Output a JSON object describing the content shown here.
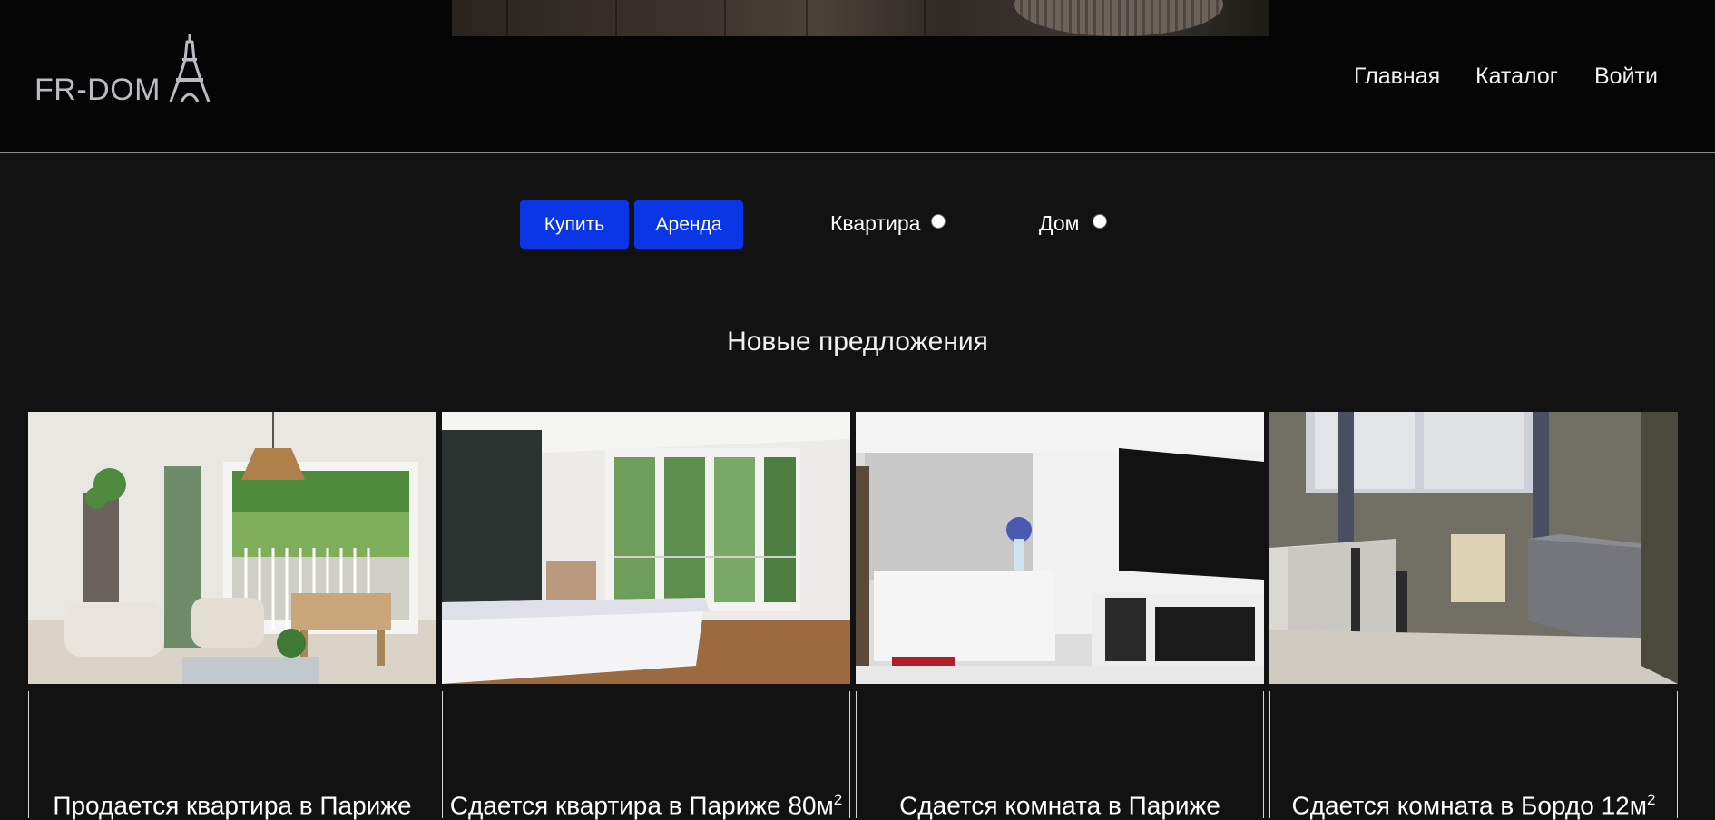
{
  "header": {
    "logo_text": "FR-DOM",
    "logo_icon": "eiffel-tower-icon",
    "nav": [
      {
        "label": "Главная"
      },
      {
        "label": "Каталог"
      },
      {
        "label": "Войти"
      }
    ]
  },
  "filters": {
    "buy_label": "Купить",
    "rent_label": "Аренда",
    "apartment_label": "Квартира",
    "house_label": "Дом"
  },
  "section": {
    "title": "Новые предложения"
  },
  "listings": [
    {
      "title": "Продается квартира в Париже",
      "superscript": ""
    },
    {
      "title": "Сдается квартира в Париже 80м",
      "superscript": "2"
    },
    {
      "title": "Сдается комната в Париже",
      "superscript": ""
    },
    {
      "title": "Сдается комната в Бордо 12м",
      "superscript": "2"
    }
  ],
  "colors": {
    "page_bg": "#121212",
    "header_bg": "#050505",
    "button_bg": "#0a36e6",
    "logo_color": "#b9bcc3"
  }
}
